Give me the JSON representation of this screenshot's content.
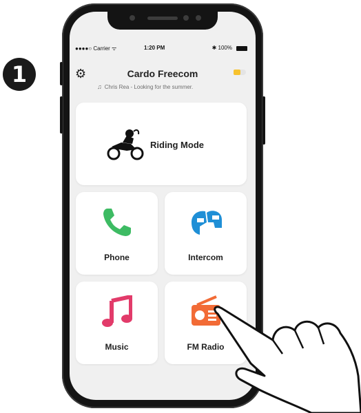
{
  "step": {
    "number": "1"
  },
  "status_bar": {
    "carrier": "●●●●○ Carrier ᯤ",
    "time": "1:20 PM",
    "battery": "✱ 100%"
  },
  "header": {
    "title": "Cardo Freecom",
    "now_playing": "Chris Rea - Looking for the summer."
  },
  "tiles": {
    "riding_mode": {
      "label": "Riding Mode",
      "icon": "motorcycle-icon"
    },
    "phone": {
      "label": "Phone",
      "icon": "phone-handset-icon",
      "color": "#3dbb63"
    },
    "intercom": {
      "label": "Intercom",
      "icon": "helmets-icon",
      "color": "#1f8fd6"
    },
    "music": {
      "label": "Music",
      "icon": "music-note-icon",
      "color": "#e23b6a"
    },
    "fm_radio": {
      "label": "FM Radio",
      "icon": "radio-icon",
      "color": "#f26b36"
    }
  },
  "colors": {
    "accent_toggle": "#f7c22e"
  }
}
